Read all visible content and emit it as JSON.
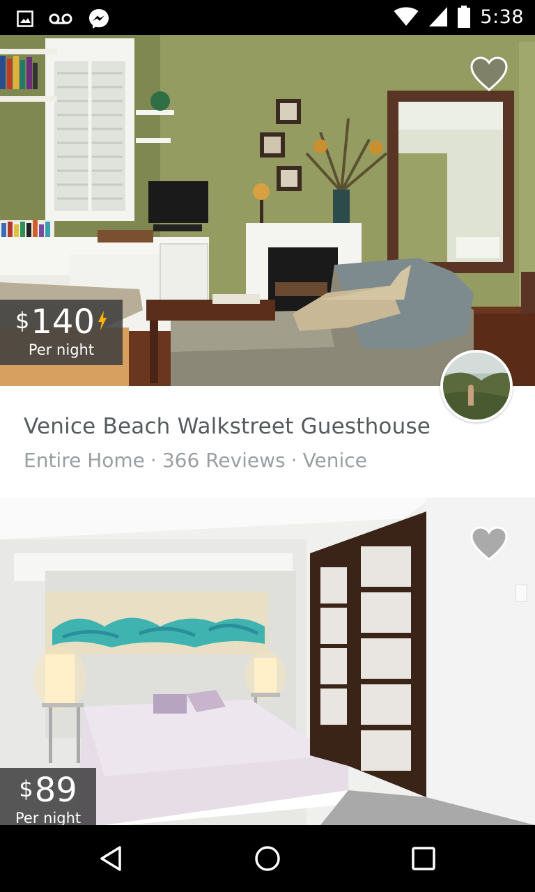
{
  "status_bar": {
    "time": "5:38",
    "left_icons": [
      "image-icon",
      "voicemail-icon",
      "messenger-icon"
    ],
    "right_icons": [
      "wifi-icon",
      "signal-icon",
      "battery-icon"
    ]
  },
  "listings": [
    {
      "price_currency": "$",
      "price_amount": "140",
      "price_unit": "Per night",
      "instant_book": true,
      "title": "Venice Beach Walkstreet Guesthouse",
      "room_type": "Entire Home",
      "reviews": "366 Reviews",
      "location": "Venice",
      "separator": "·",
      "photo_subject": "living-room",
      "wishlisted": false
    },
    {
      "price_currency": "$",
      "price_amount": "89",
      "price_unit": "Per night",
      "instant_book": false,
      "photo_subject": "bedroom",
      "wishlisted": false
    }
  ],
  "nav_bar": {
    "buttons": [
      "back-icon",
      "home-icon",
      "recents-icon"
    ]
  },
  "colors": {
    "text_primary": "#565a5c",
    "text_secondary": "#9a9fa1",
    "instant_book_bolt": "#ffb400",
    "price_tag_bg": "#3c3c3c"
  }
}
